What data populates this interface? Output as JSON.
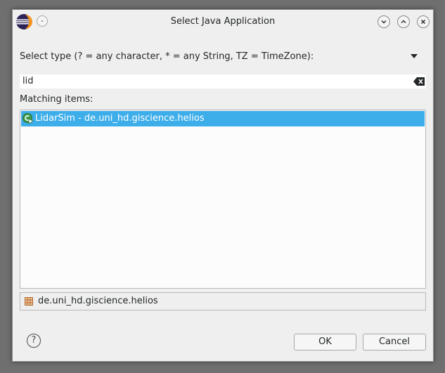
{
  "window": {
    "title": "Select Java Application",
    "buttons": [
      "minimize",
      "maximize",
      "close"
    ]
  },
  "type_prompt": "Select type (? = any character, * = any String, TZ = TimeZone):",
  "search": {
    "value": "lid"
  },
  "matching_label": "Matching items:",
  "items": [
    {
      "label": "LidarSim - de.uni_hd.giscience.helios",
      "selected": true,
      "icon": "java-main-class-icon"
    }
  ],
  "package": {
    "label": "de.uni_hd.giscience.helios",
    "icon": "package-icon"
  },
  "buttons": {
    "ok": "OK",
    "cancel": "Cancel"
  },
  "colors": {
    "selection": "#3daee9",
    "background": "#efefef"
  }
}
